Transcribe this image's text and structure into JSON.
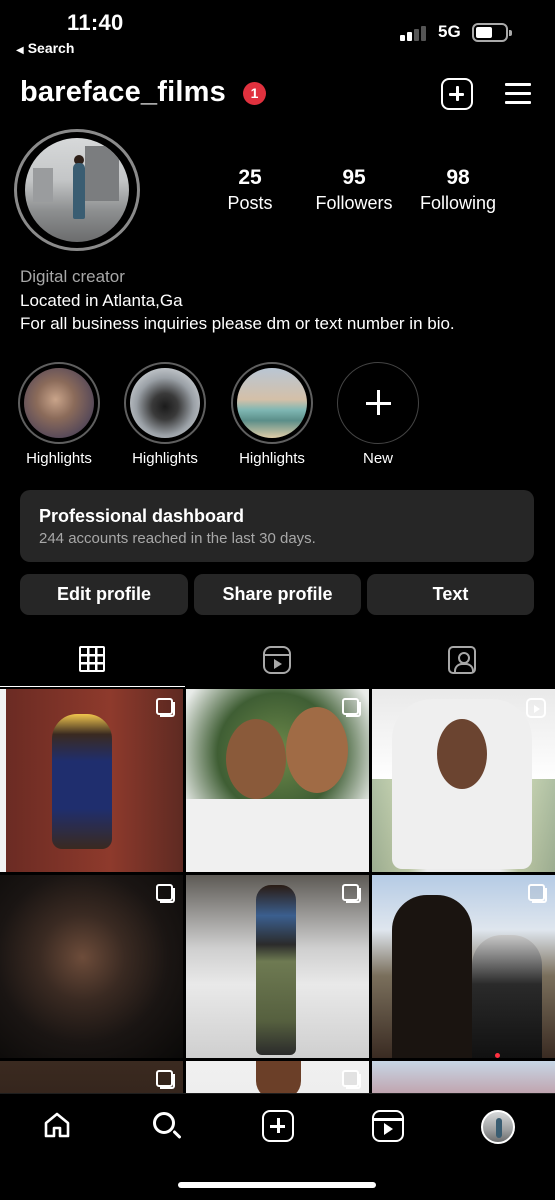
{
  "status_bar": {
    "time": "11:40",
    "back_label": "Search",
    "network": "5G"
  },
  "header": {
    "username": "bareface_films",
    "notification_count": "1"
  },
  "profile": {
    "stats": [
      {
        "value": "25",
        "label": "Posts"
      },
      {
        "value": "95",
        "label": "Followers"
      },
      {
        "value": "98",
        "label": "Following"
      }
    ],
    "category": "Digital creator",
    "bio_line1": "Located in Atlanta,Ga",
    "bio_line2": "For all business inquiries please dm or text number in bio."
  },
  "highlights": [
    {
      "label": "Highlights"
    },
    {
      "label": "Highlights"
    },
    {
      "label": "Highlights"
    },
    {
      "label": "New"
    }
  ],
  "dashboard": {
    "title": "Professional dashboard",
    "subtitle": "244 accounts reached in the last 30 days."
  },
  "buttons": {
    "edit": "Edit profile",
    "share": "Share profile",
    "text": "Text"
  },
  "tabs": [
    "grid-icon",
    "reels-icon",
    "tagged-icon"
  ],
  "nav": [
    "home-icon",
    "search-icon",
    "create-icon",
    "reels-icon",
    "profile-avatar"
  ],
  "colors": {
    "background": "#000000",
    "surface": "#262626",
    "secondary_text": "#a8a8a8",
    "badge": "#e0313e"
  }
}
